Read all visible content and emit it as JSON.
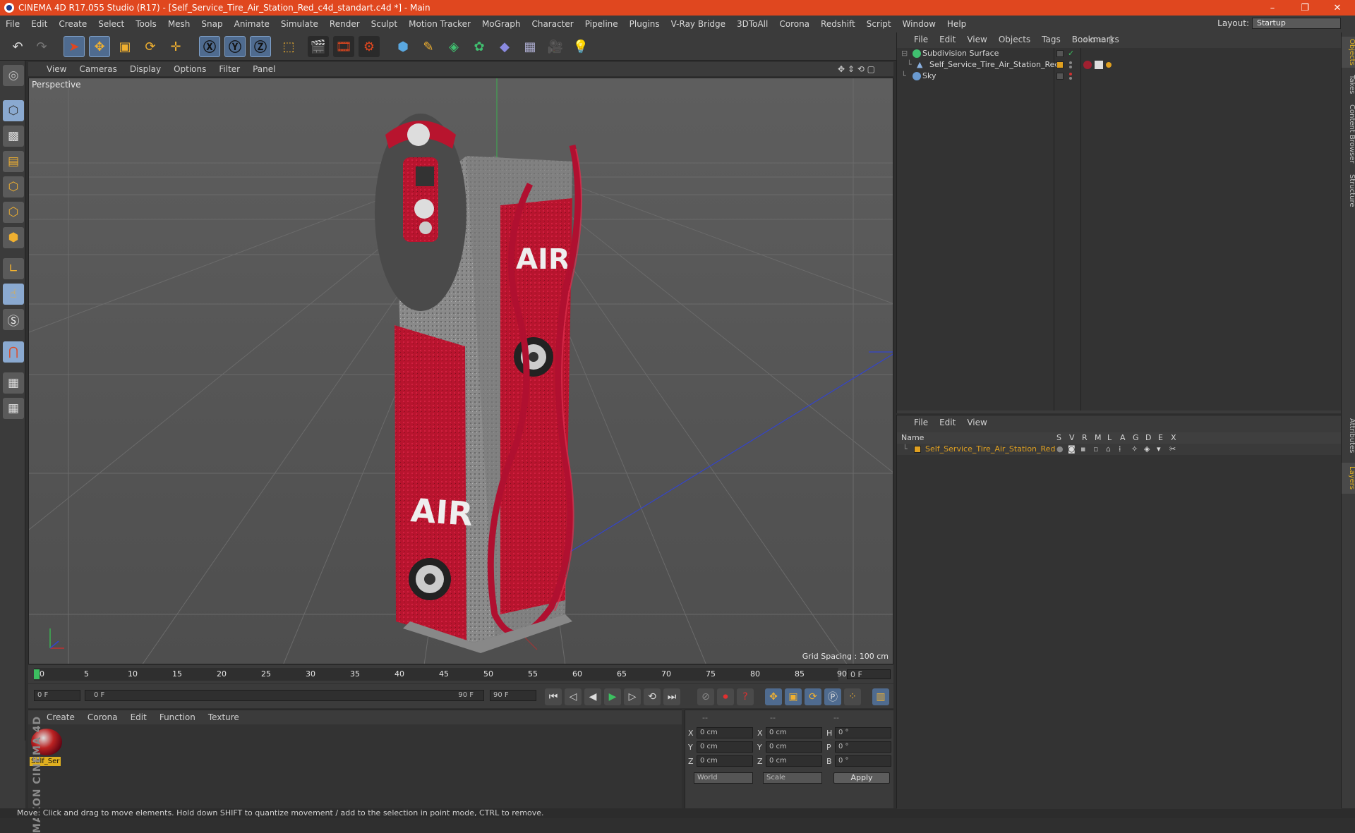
{
  "titlebar": {
    "title": "CINEMA 4D R17.055 Studio (R17) - [Self_Service_Tire_Air_Station_Red_c4d_standart.c4d *] - Main",
    "minimize": "–",
    "restore": "❐",
    "close": "✕"
  },
  "menubar": {
    "items": [
      "File",
      "Edit",
      "Create",
      "Select",
      "Tools",
      "Mesh",
      "Snap",
      "Animate",
      "Simulate",
      "Render",
      "Sculpt",
      "Motion Tracker",
      "MoGraph",
      "Character",
      "Pipeline",
      "Plugins",
      "V-Ray Bridge",
      "3DToAll",
      "Corona",
      "Redshift",
      "Script",
      "Window",
      "Help"
    ],
    "layout_label": "Layout:",
    "layout_value": "Startup"
  },
  "toolbar": {
    "icons": [
      "undo-icon",
      "redo-icon",
      "select-pointer-icon",
      "move-icon",
      "scale-icon",
      "rotate-icon",
      "transform-icon",
      "x-axis-icon",
      "y-axis-icon",
      "z-axis-icon",
      "coordinate-system-icon",
      "render-view-icon",
      "render-picture-viewer-icon",
      "render-settings-icon",
      "cube-primitive-icon",
      "spline-pen-icon",
      "subdivision-icon",
      "cloner-icon",
      "deformer-icon",
      "floor-icon",
      "camera-icon",
      "light-icon"
    ]
  },
  "viewport": {
    "menu": [
      "View",
      "Cameras",
      "Display",
      "Options",
      "Filter",
      "Panel"
    ],
    "label": "Perspective",
    "grid_spacing": "Grid Spacing : 100 cm",
    "accent_red": "#c21a35"
  },
  "timeline": {
    "ticks": [
      "0",
      "5",
      "10",
      "15",
      "20",
      "25",
      "30",
      "35",
      "40",
      "45",
      "50",
      "55",
      "60",
      "65",
      "70",
      "75",
      "80",
      "85",
      "90"
    ],
    "current_frame": "0 F"
  },
  "controls": {
    "start_frame": "0 F",
    "range_start": "0 F",
    "range_end": "90 F",
    "end_frame": "90 F"
  },
  "material_manager": {
    "menu": [
      "Create",
      "Corona",
      "Edit",
      "Function",
      "Texture"
    ],
    "material_name": "Self_Ser"
  },
  "coordinates": {
    "header": [
      "--",
      "--",
      "--"
    ],
    "rows": [
      {
        "a": "X",
        "av": "0 cm",
        "b": "X",
        "bv": "0 cm",
        "c": "H",
        "cv": "0 °"
      },
      {
        "a": "Y",
        "av": "0 cm",
        "b": "Y",
        "bv": "0 cm",
        "c": "P",
        "cv": "0 °"
      },
      {
        "a": "Z",
        "av": "0 cm",
        "b": "Z",
        "bv": "0 cm",
        "c": "B",
        "cv": "0 °"
      }
    ],
    "space": "World",
    "mode": "Scale",
    "apply": "Apply"
  },
  "object_manager": {
    "menu": [
      "File",
      "Edit",
      "View",
      "Objects",
      "Tags",
      "Bookmarks"
    ],
    "objects": [
      {
        "name": "Subdivision Surface"
      },
      {
        "name": "Self_Service_Tire_Air_Station_Red"
      },
      {
        "name": "Sky"
      }
    ]
  },
  "layer_manager": {
    "menu": [
      "File",
      "Edit",
      "View"
    ],
    "columns": [
      "Name",
      "S",
      "V",
      "R",
      "M",
      "L",
      "A",
      "G",
      "D",
      "E",
      "X"
    ],
    "layer_name": "Self_Service_Tire_Air_Station_Red",
    "layer_color": "#e0a020"
  },
  "right_tabs": [
    "Objects",
    "Takes",
    "Content Browser",
    "Structure",
    "Attributes",
    "Layers"
  ],
  "branding": "MAXON CINEMA 4D",
  "statusbar": "Move: Click and drag to move elements. Hold down SHIFT to quantize movement / add to the selection in point mode, CTRL to remove."
}
